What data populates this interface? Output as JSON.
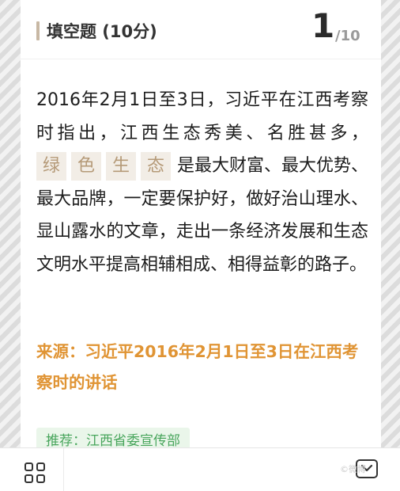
{
  "header": {
    "title": "填空题 (10分)",
    "current": "1",
    "total": "/10"
  },
  "question": {
    "text_before": "2016年2月1日至3日，习近平在江西考察时指出，江西生态秀美、名胜甚多，",
    "blanks": [
      "绿",
      "色",
      "生",
      "态"
    ],
    "text_after": "是最大财富、最大优势、最大品牌，一定要保护好，做好治山理水、显山露水的文章，走出一条经济发展和生态文明水平提高相辅相成、相得益彰的路子。"
  },
  "source": "来源：习近平2016年2月1日至3日在江西考察时的讲话",
  "recommend": "推荐：江西省委宣传部",
  "watermark": "©微博"
}
